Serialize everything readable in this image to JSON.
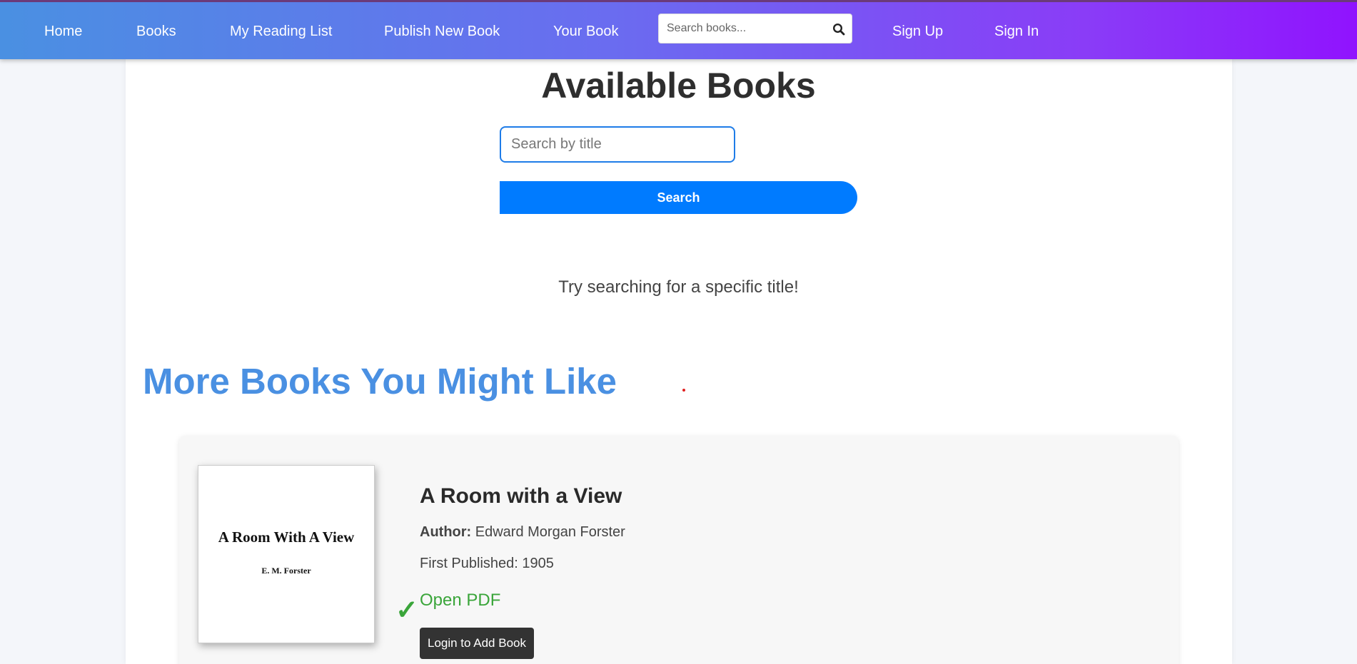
{
  "nav": {
    "items": [
      {
        "label": "Home"
      },
      {
        "label": "Books"
      },
      {
        "label": "My Reading List"
      },
      {
        "label": "Publish New Book"
      },
      {
        "label": "Your Book"
      }
    ],
    "search_placeholder": "Search books...",
    "search_icon": "search-icon",
    "auth": [
      {
        "label": "Sign Up"
      },
      {
        "label": "Sign In"
      }
    ]
  },
  "main": {
    "title": "Available Books",
    "search_placeholder": "Search by title",
    "search_button": "Search",
    "hint": "Try searching for a specific title!",
    "section_title": "More Books You Might Like"
  },
  "book": {
    "cover_title": "A Room With A View",
    "cover_author": "E. M. Forster",
    "title": "A Room with a View",
    "author_label": "Author:",
    "author": "Edward Morgan Forster",
    "first_published": "First Published: 1905",
    "check_icon": "check-icon",
    "open_pdf": "Open PDF",
    "login_button": "Login to Add Book"
  },
  "colors": {
    "accent": "#4a90e2",
    "button_blue": "#007bff",
    "pdf_green": "#3aa53a",
    "nav_gradient_start": "#4a90e2",
    "nav_gradient_end": "#9013fe"
  }
}
